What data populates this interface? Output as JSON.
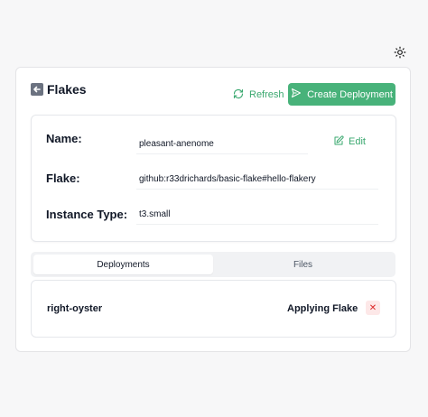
{
  "header": {
    "title": "Flakes",
    "refresh_label": "Refresh",
    "create_label": "Create Deployment"
  },
  "details": {
    "name_label": "Name:",
    "name_value": "pleasant-anenome",
    "edit_label": "Edit",
    "flake_label": "Flake:",
    "flake_value": "github:r33drichards/basic-flake#hello-flakery",
    "instance_type_label": "Instance Type:",
    "instance_type_value": "t3.small"
  },
  "tabs": [
    {
      "label": "Deployments",
      "active": true
    },
    {
      "label": "Files",
      "active": false
    }
  ],
  "deployments": [
    {
      "name": "right-oyster",
      "status": "Applying Flake",
      "action_icon": "close-icon"
    }
  ],
  "colors": {
    "accent": "#48b27a",
    "accent_text": "#3aa86f",
    "danger": "#dc2626",
    "danger_bg": "#fde8e8"
  },
  "icons": {
    "theme": "sun-icon",
    "back": "back-arrow-icon",
    "refresh": "refresh-icon",
    "create": "send-icon",
    "edit": "edit-icon"
  }
}
